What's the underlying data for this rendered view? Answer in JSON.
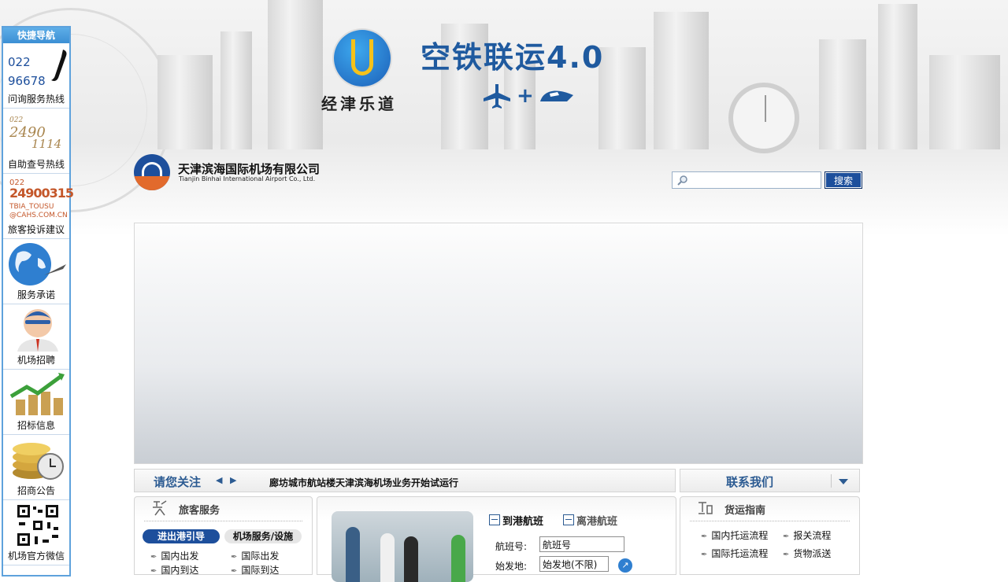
{
  "banner": {
    "slogan": "经津乐道",
    "title": "空铁联运4.0",
    "plus": "+"
  },
  "quicknav": {
    "title": "快捷导航",
    "items": [
      {
        "label": "问询服务热线",
        "line1": "022",
        "line2": "96678",
        "icon": "phone-icon"
      },
      {
        "label": "自助查号热线",
        "line1": "022",
        "line2": "2490",
        "line3": "1114",
        "icon": "handwritten-number"
      },
      {
        "label": "旅客投诉建议",
        "line1": "022",
        "line2": "24900315",
        "line3": "TBIA_TOUSU",
        "line4": "@CAHS.COM.CN"
      },
      {
        "label": "服务承诺",
        "icon": "globe-icon"
      },
      {
        "label": "机场招聘",
        "icon": "person-icon"
      },
      {
        "label": "招标信息",
        "icon": "coins-chart-icon"
      },
      {
        "label": "招商公告",
        "icon": "coins-clock-icon"
      },
      {
        "label": "机场官方微信",
        "icon": "qr-code-icon"
      }
    ]
  },
  "header": {
    "company_cn": "天津滨海国际机场有限公司",
    "company_en": "Tianjin Binhai International Airport Co., Ltd.",
    "search_placeholder": "",
    "search_button": "搜索"
  },
  "notice": {
    "title": "请您关注",
    "prev": "◀",
    "next": "▶",
    "text": "廊坊城市航站楼天津滨海机场业务开始试运行"
  },
  "contact": {
    "title": "联系我们"
  },
  "passenger": {
    "heading": "旅客服务",
    "tab_active": "进出港引导",
    "tab_other": "机场服务/设施",
    "links": [
      "国内出发",
      "国际出发",
      "国内到达",
      "国际到达"
    ]
  },
  "flights": {
    "tab_arrival": "到港航班",
    "tab_departure": "离港航班",
    "flight_no_label": "航班号:",
    "flight_no_value": "航班号",
    "origin_label": "始发地:",
    "origin_value": "始发地(不限)",
    "go": "↗"
  },
  "cargo": {
    "heading": "货运指南",
    "links": [
      "国内托运流程",
      "报关流程",
      "国际托运流程",
      "货物派送"
    ]
  },
  "colors": {
    "brand_blue": "#1d4f9c",
    "heading_blue": "#2c5b92",
    "accent_orange": "#e26a2c",
    "quicknav_border": "#5ea2dc"
  }
}
